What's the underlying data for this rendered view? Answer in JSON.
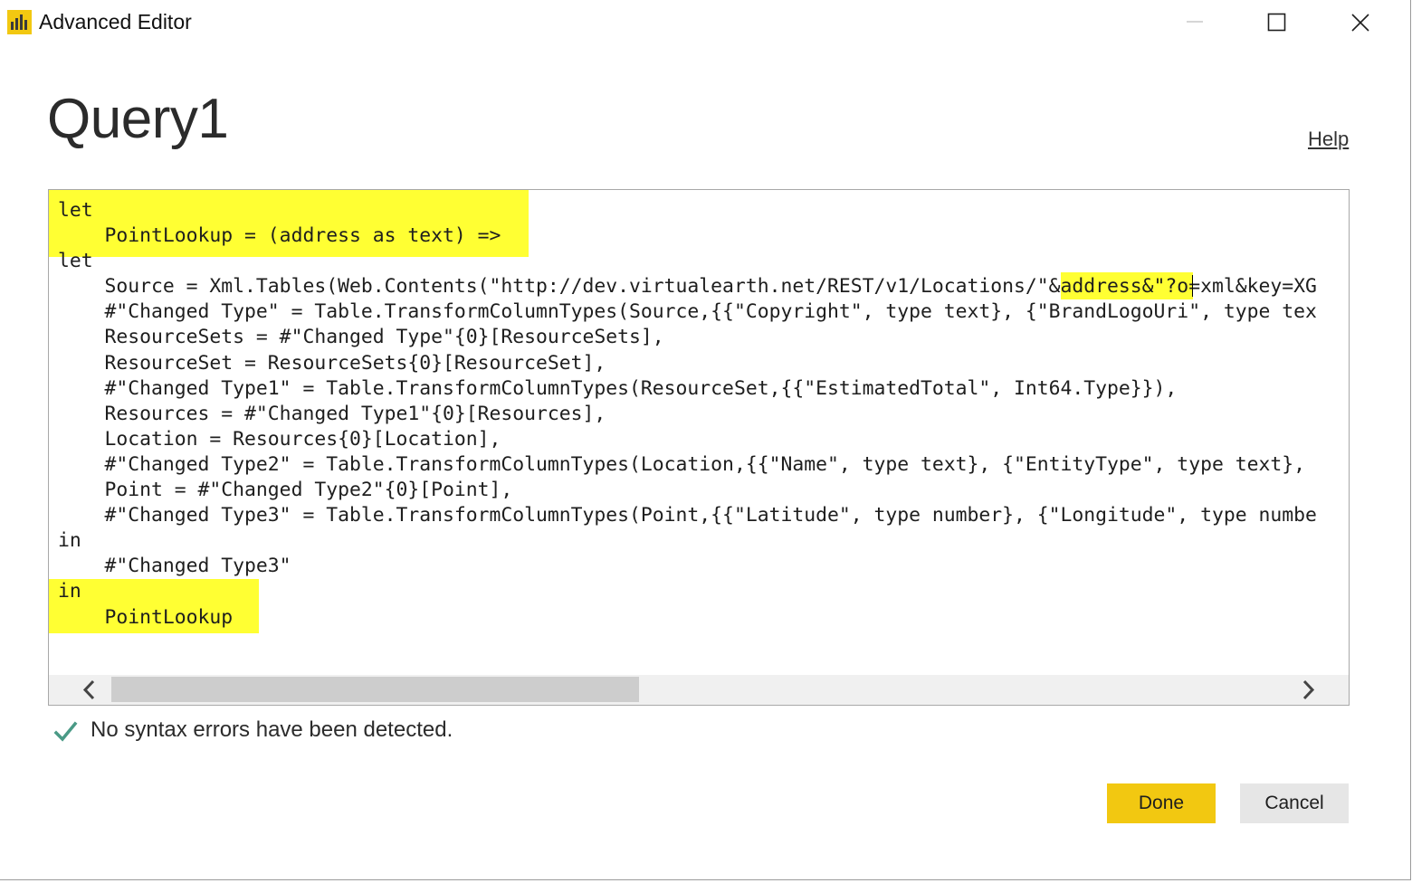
{
  "window": {
    "title": "Advanced Editor",
    "app_icon": "power-bi-icon",
    "controls": {
      "minimize_icon": "minimize-icon",
      "maximize_icon": "maximize-icon",
      "close_icon": "close-icon"
    }
  },
  "header": {
    "query_name": "Query1",
    "help_label": "Help"
  },
  "editor": {
    "lines": [
      "let",
      "    PointLookup = (address as text) =>",
      "let",
      "    Source = Xml.Tables(Web.Contents(\"http://dev.virtualearth.net/REST/v1/Locations/\"&address&\"?o=xml&key=XG",
      "    #\"Changed Type\" = Table.TransformColumnTypes(Source,{{\"Copyright\", type text}, {\"BrandLogoUri\", type tex",
      "    ResourceSets = #\"Changed Type\"{0}[ResourceSets],",
      "    ResourceSet = ResourceSets{0}[ResourceSet],",
      "    #\"Changed Type1\" = Table.TransformColumnTypes(ResourceSet,{{\"EstimatedTotal\", Int64.Type}}),",
      "    Resources = #\"Changed Type1\"{0}[Resources],",
      "    Location = Resources{0}[Location],",
      "    #\"Changed Type2\" = Table.TransformColumnTypes(Location,{{\"Name\", type text}, {\"EntityType\", type text},",
      "    Point = #\"Changed Type2\"{0}[Point],",
      "    #\"Changed Type3\" = Table.TransformColumnTypes(Point,{{\"Latitude\", type number}, {\"Longitude\", type numbe",
      "in",
      "    #\"Changed Type3\"",
      "in",
      "    PointLookup"
    ],
    "highlight_color": "#ffff33",
    "scrollbar": {
      "left_icon": "chevron-left-icon",
      "right_icon": "chevron-right-icon"
    }
  },
  "status": {
    "icon": "check-icon",
    "icon_color": "#4a9a86",
    "message": "No syntax errors have been detected."
  },
  "footer": {
    "done_label": "Done",
    "cancel_label": "Cancel",
    "accent_color": "#f2c811"
  }
}
